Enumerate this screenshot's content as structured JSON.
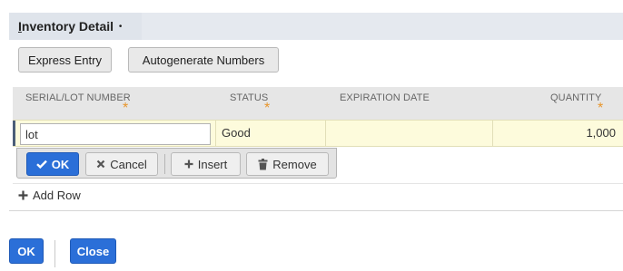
{
  "panel": {
    "title_first_letter": "I",
    "title_rest": "nventory Detail",
    "title_marker": "•"
  },
  "toolbar": {
    "express_entry": "Express Entry",
    "autogenerate": "Autogenerate Numbers"
  },
  "grid": {
    "columns": [
      "SERIAL/LOT NUMBER",
      "STATUS",
      "EXPIRATION DATE",
      "QUANTITY"
    ],
    "required_marker": "*",
    "row": {
      "serial_lot_value": "lot",
      "status": "Good",
      "expiration_date": "",
      "quantity": "1,000"
    }
  },
  "row_actions": {
    "ok": "OK",
    "cancel": "Cancel",
    "insert": "Insert",
    "remove": "Remove"
  },
  "add_row": "Add Row",
  "footer": {
    "ok": "OK",
    "close": "Close"
  },
  "colors": {
    "primary": "#2b6fd8",
    "required": "#e8962c",
    "active_row": "#fdfbdc"
  },
  "icons": {
    "ok": "check-icon",
    "cancel": "x-icon",
    "insert": "plus-icon",
    "remove": "trash-icon",
    "add_row": "plus-icon"
  }
}
